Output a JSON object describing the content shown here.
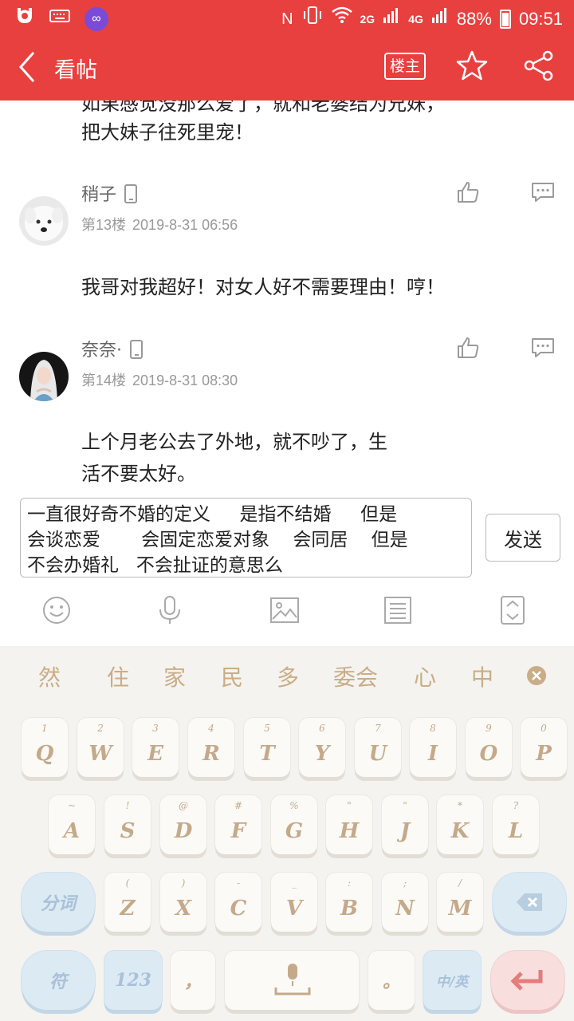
{
  "status_bar": {
    "nfc": "N",
    "net_2g": "2G",
    "net_4g": "4G",
    "battery": "88%",
    "time": "09:51"
  },
  "header": {
    "title": "看帖",
    "owner_label": "楼主"
  },
  "content": {
    "prev_post_partial": "如果感觉没那么爱了，就和老婆结为兄妹，",
    "prev_post_line2": "把大妹子往死里宠！",
    "posts": [
      {
        "username": "稍子",
        "floor": "第13楼",
        "datetime": "2019-8-31 06:56",
        "text_line1": "我哥对我超好！对女人好不需要理由！哼！"
      },
      {
        "username": "奈奈·",
        "floor": "第14楼",
        "datetime": "2019-8-31 08:30",
        "text_line1": "上个月老公去了外地，就不吵了，生",
        "text_line2": "活不要太好。"
      }
    ]
  },
  "composer": {
    "line1": "一直很好奇不婚的定义     是指不结婚     但是",
    "line2": "会谈恋爱       会固定恋爱对象    会同居    但是",
    "line3": "不会办婚礼   不会扯证的意思么",
    "send_label": "发送"
  },
  "keyboard": {
    "candidates": [
      "然",
      "住",
      "家",
      "民",
      "多",
      "委会",
      "心",
      "中"
    ],
    "row1": [
      {
        "main": "Q",
        "sub": "1"
      },
      {
        "main": "W",
        "sub": "2"
      },
      {
        "main": "E",
        "sub": "3"
      },
      {
        "main": "R",
        "sub": "4"
      },
      {
        "main": "T",
        "sub": "5"
      },
      {
        "main": "Y",
        "sub": "6"
      },
      {
        "main": "U",
        "sub": "7"
      },
      {
        "main": "I",
        "sub": "8"
      },
      {
        "main": "O",
        "sub": "9"
      },
      {
        "main": "P",
        "sub": "0"
      }
    ],
    "row2": [
      {
        "main": "A",
        "sub": "~"
      },
      {
        "main": "S",
        "sub": "!"
      },
      {
        "main": "D",
        "sub": "@"
      },
      {
        "main": "F",
        "sub": "#"
      },
      {
        "main": "G",
        "sub": "%"
      },
      {
        "main": "H",
        "sub": "\""
      },
      {
        "main": "J",
        "sub": "\""
      },
      {
        "main": "K",
        "sub": "*"
      },
      {
        "main": "L",
        "sub": "?"
      }
    ],
    "row3": [
      {
        "main": "Z",
        "sub": "("
      },
      {
        "main": "X",
        "sub": ")"
      },
      {
        "main": "C",
        "sub": "-"
      },
      {
        "main": "V",
        "sub": "_"
      },
      {
        "main": "B",
        "sub": ":"
      },
      {
        "main": "N",
        "sub": ";"
      },
      {
        "main": "M",
        "sub": "/"
      }
    ],
    "split_label": "分词",
    "symbol_label": "符",
    "num_label": "123",
    "comma_label": "，",
    "period_label": "。",
    "lang_label": "中/英"
  },
  "colors": {
    "brand_red": "#e8403e",
    "key_text": "#c4a98a",
    "key_blue": "#dceaf4",
    "key_pink": "#f9dede"
  }
}
